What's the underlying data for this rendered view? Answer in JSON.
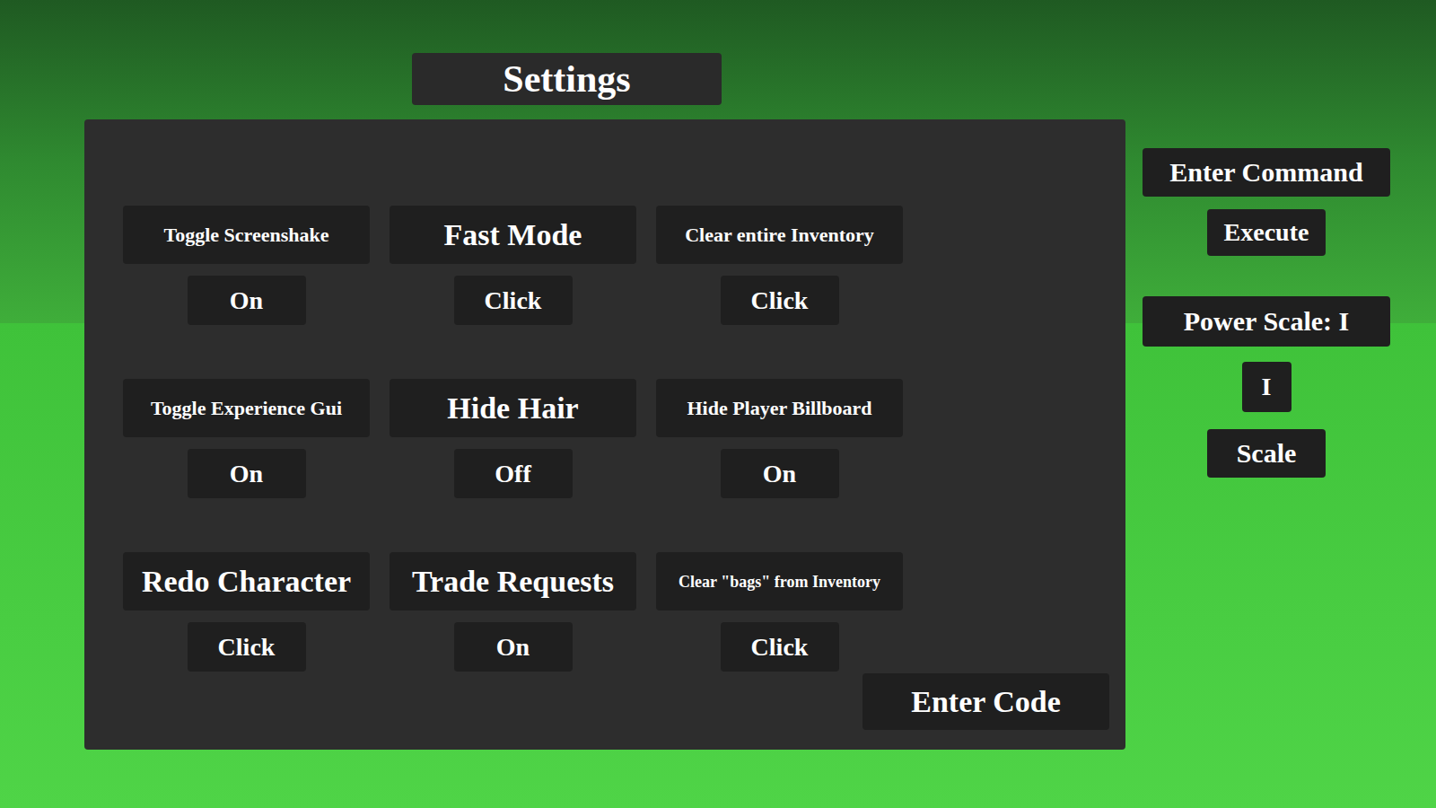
{
  "settings": {
    "title": "Settings",
    "options": [
      {
        "label": "Toggle Screenshake",
        "button": "On"
      },
      {
        "label": "Fast Mode",
        "button": "Click"
      },
      {
        "label": "Clear entire Inventory",
        "button": "Click"
      },
      {
        "label": "Toggle Experience Gui",
        "button": "On"
      },
      {
        "label": "Hide Hair",
        "button": "Off"
      },
      {
        "label": "Hide Player Billboard",
        "button": "On"
      },
      {
        "label": "Redo Character",
        "button": "Click"
      },
      {
        "label": "Trade Requests",
        "button": "On"
      },
      {
        "label": "Clear \"bags\" from Inventory",
        "button": "Click"
      }
    ],
    "code_field": {
      "placeholder": "Enter Code"
    }
  },
  "side_panel": {
    "command_field": {
      "placeholder": "Enter Command"
    },
    "execute_button": "Execute",
    "power_scale_label": "Power Scale: I",
    "scale_field": {
      "value": "I"
    },
    "scale_button": "Scale"
  }
}
